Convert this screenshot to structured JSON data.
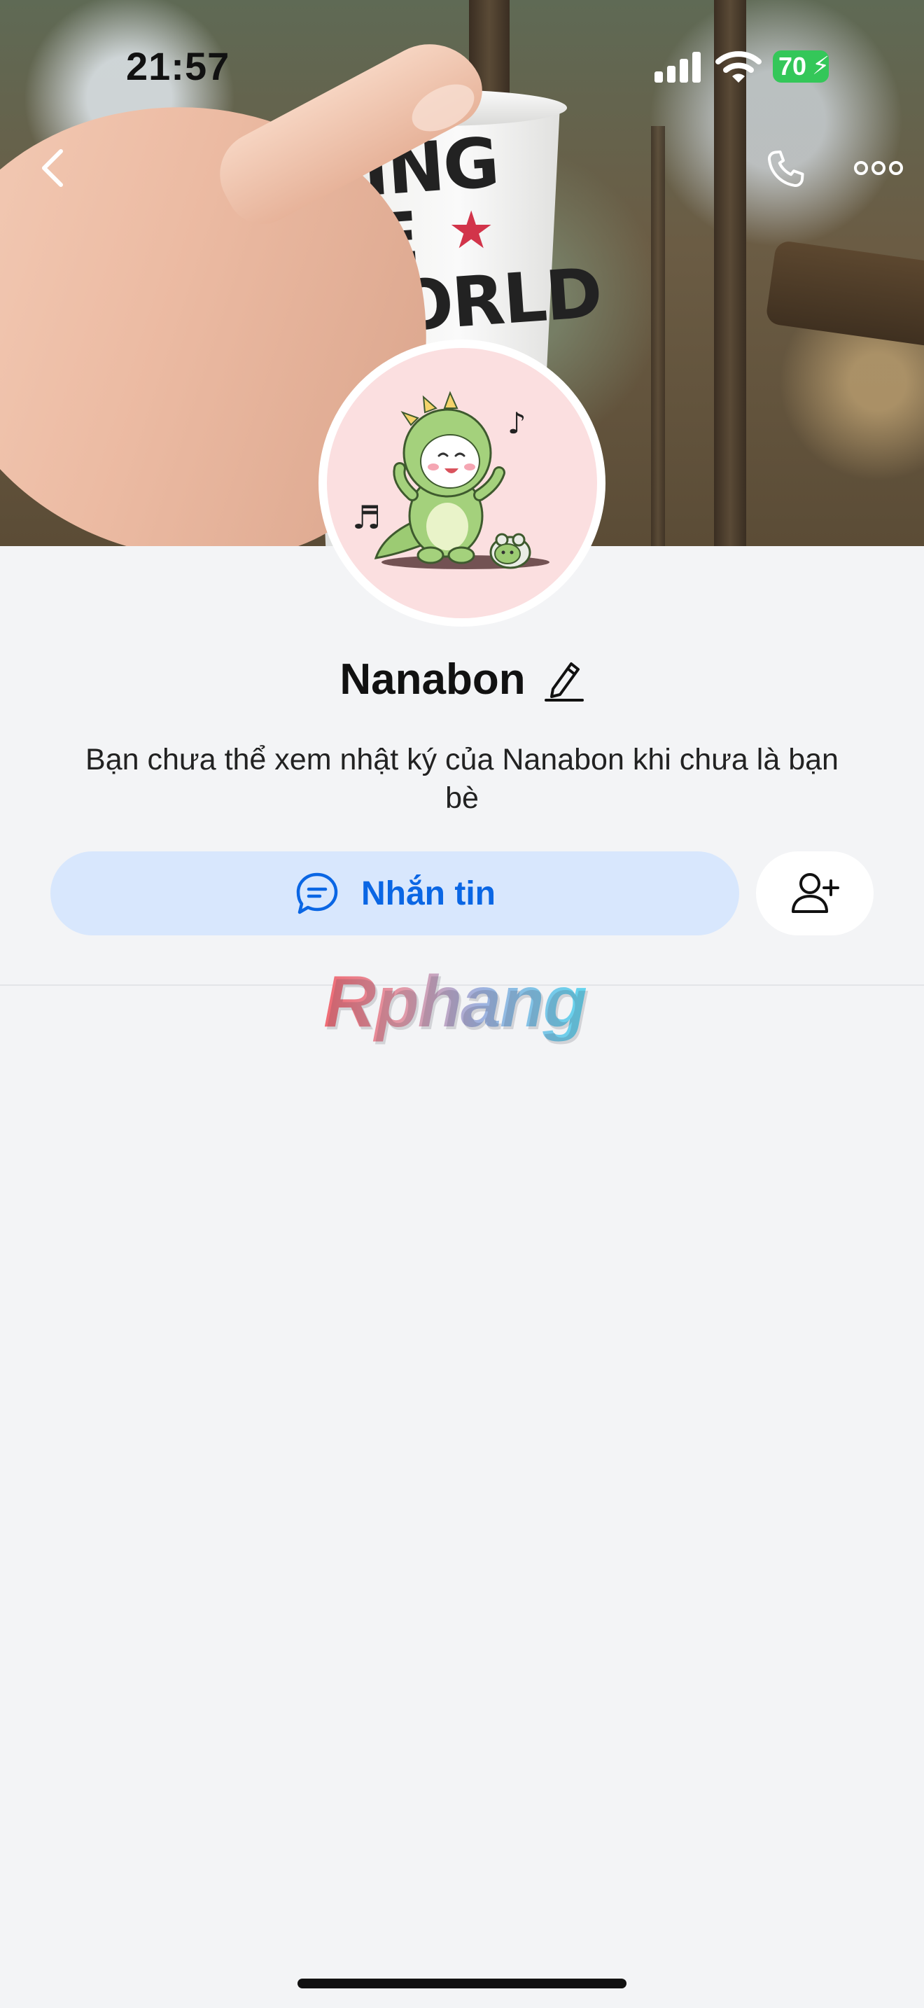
{
  "status_bar": {
    "time": "21:57",
    "battery_level": "70",
    "icons": [
      "signal-icon",
      "wifi-icon",
      "battery-icon",
      "charging-bolt-icon"
    ]
  },
  "cover": {
    "cup_text": "KING\nHE\nWORLD\nWA"
  },
  "nav": {
    "icons": [
      "chevron-left-icon",
      "phone-icon",
      "more-horizontal-icon"
    ]
  },
  "profile": {
    "name": "Nanabon",
    "privacy_note": "Bạn chưa thể xem nhật ký của Nanabon khi chưa là bạn bè"
  },
  "actions": {
    "message_label": "Nhắn tin",
    "message_icon": "chat-bubble-icon",
    "add_friend_icon": "add-user-icon"
  },
  "watermark": {
    "text": "Rphang"
  },
  "colors": {
    "accent": "#0a66e4",
    "message_button_bg": "#d8e7fd",
    "page_bg": "#f3f4f6",
    "battery_green": "#34c759"
  }
}
